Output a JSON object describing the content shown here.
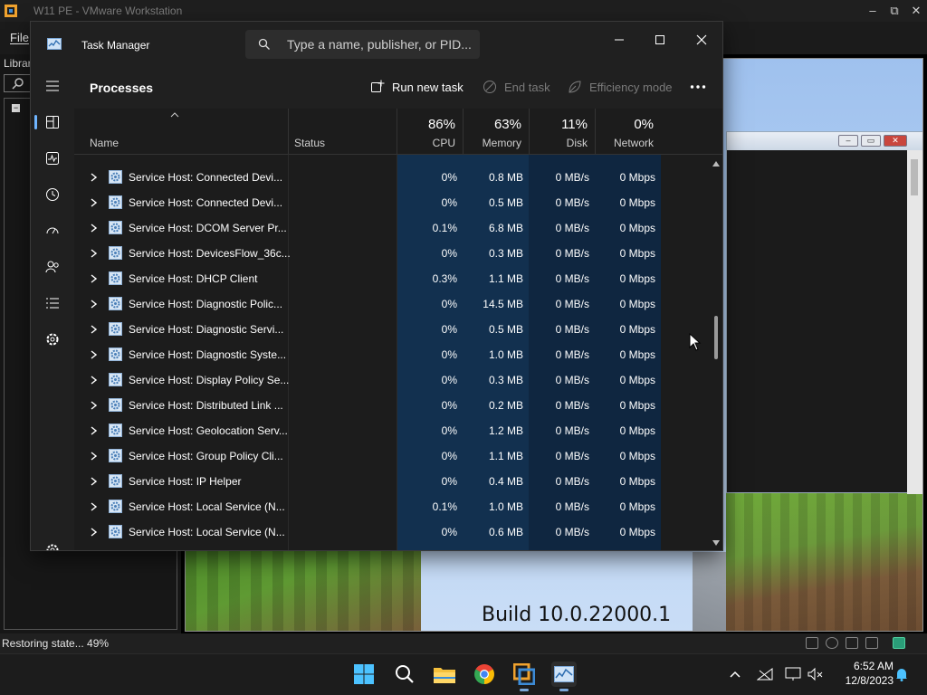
{
  "vmware": {
    "title": "W11 PE - VMware Workstation",
    "menu_file": "File",
    "library_label": "Librar",
    "status_text": "Restoring state... 49%"
  },
  "guest": {
    "build_text": "Build 10.0.22000.1"
  },
  "task_manager": {
    "title": "Task Manager",
    "search_placeholder": "Type a name, publisher, or PID...",
    "page_title": "Processes",
    "run_new_task": "Run new task",
    "end_task": "End task",
    "efficiency_mode": "Efficiency mode",
    "columns": {
      "name": "Name",
      "status": "Status",
      "cpu": {
        "percent": "86%",
        "label": "CPU"
      },
      "memory": {
        "percent": "63%",
        "label": "Memory"
      },
      "disk": {
        "percent": "11%",
        "label": "Disk"
      },
      "network": {
        "percent": "0%",
        "label": "Network"
      }
    },
    "rows": [
      {
        "name": "Service Host: Connected Devi...",
        "cpu": "0%",
        "memory": "0.8 MB",
        "disk": "0 MB/s",
        "network": "0 Mbps"
      },
      {
        "name": "Service Host: Connected Devi...",
        "cpu": "0%",
        "memory": "0.5 MB",
        "disk": "0 MB/s",
        "network": "0 Mbps"
      },
      {
        "name": "Service Host: DCOM Server Pr...",
        "cpu": "0.1%",
        "memory": "6.8 MB",
        "disk": "0 MB/s",
        "network": "0 Mbps"
      },
      {
        "name": "Service Host: DevicesFlow_36c...",
        "cpu": "0%",
        "memory": "0.3 MB",
        "disk": "0 MB/s",
        "network": "0 Mbps"
      },
      {
        "name": "Service Host: DHCP Client",
        "cpu": "0.3%",
        "memory": "1.1 MB",
        "disk": "0 MB/s",
        "network": "0 Mbps"
      },
      {
        "name": "Service Host: Diagnostic Polic...",
        "cpu": "0%",
        "memory": "14.5 MB",
        "disk": "0 MB/s",
        "network": "0 Mbps"
      },
      {
        "name": "Service Host: Diagnostic Servi...",
        "cpu": "0%",
        "memory": "0.5 MB",
        "disk": "0 MB/s",
        "network": "0 Mbps"
      },
      {
        "name": "Service Host: Diagnostic Syste...",
        "cpu": "0%",
        "memory": "1.0 MB",
        "disk": "0 MB/s",
        "network": "0 Mbps"
      },
      {
        "name": "Service Host: Display Policy Se...",
        "cpu": "0%",
        "memory": "0.3 MB",
        "disk": "0 MB/s",
        "network": "0 Mbps"
      },
      {
        "name": "Service Host: Distributed Link ...",
        "cpu": "0%",
        "memory": "0.2 MB",
        "disk": "0 MB/s",
        "network": "0 Mbps"
      },
      {
        "name": "Service Host: Geolocation Serv...",
        "cpu": "0%",
        "memory": "1.2 MB",
        "disk": "0 MB/s",
        "network": "0 Mbps"
      },
      {
        "name": "Service Host: Group Policy Cli...",
        "cpu": "0%",
        "memory": "1.1 MB",
        "disk": "0 MB/s",
        "network": "0 Mbps"
      },
      {
        "name": "Service Host: IP Helper",
        "cpu": "0%",
        "memory": "0.4 MB",
        "disk": "0 MB/s",
        "network": "0 Mbps"
      },
      {
        "name": "Service Host: Local Service (N...",
        "cpu": "0.1%",
        "memory": "1.0 MB",
        "disk": "0 MB/s",
        "network": "0 Mbps"
      },
      {
        "name": "Service Host: Local Service (N...",
        "cpu": "0%",
        "memory": "0.6 MB",
        "disk": "0 MB/s",
        "network": "0 Mbps"
      }
    ],
    "heat_colors": {
      "cpu": "#12304f",
      "memory": "#12304f",
      "disk": "#0f2640",
      "network": "#0f2640"
    },
    "nav_items": [
      "processes-icon",
      "performance-icon",
      "app-history-icon",
      "startup-apps-icon",
      "users-icon",
      "details-icon",
      "services-icon",
      "settings-icon"
    ]
  },
  "taskbar": {
    "apps": [
      "start-icon",
      "search-icon",
      "file-explorer-icon",
      "chrome-icon",
      "vmware-icon",
      "task-manager-icon"
    ],
    "time": "6:52 AM",
    "date": "12/8/2023"
  }
}
